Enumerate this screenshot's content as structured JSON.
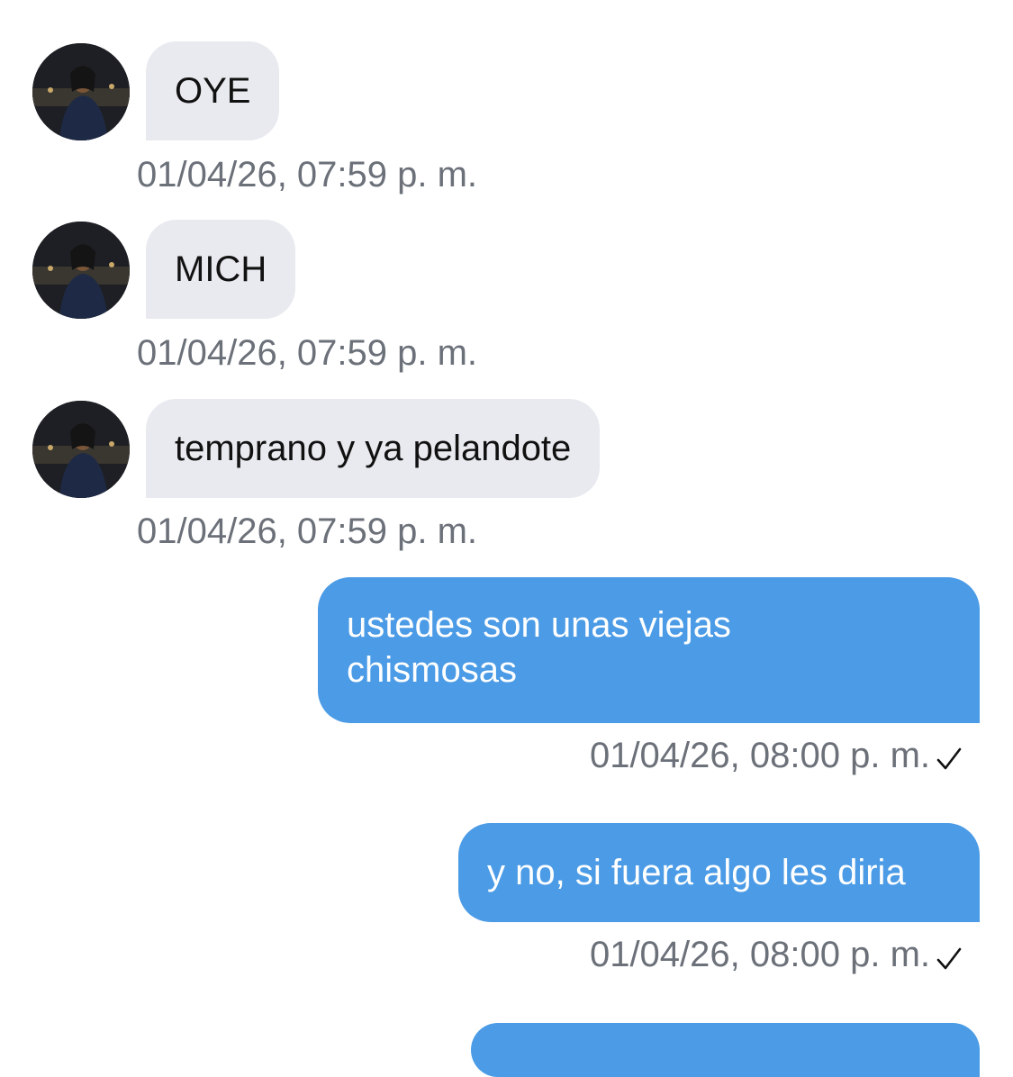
{
  "messages": [
    {
      "direction": "incoming",
      "text": "OYE",
      "timestamp": "01/04/26, 07:59 p. m."
    },
    {
      "direction": "incoming",
      "text": "MICH",
      "timestamp": "01/04/26, 07:59 p. m."
    },
    {
      "direction": "incoming",
      "text": "temprano y ya pelandote",
      "timestamp": "01/04/26, 07:59 p. m."
    },
    {
      "direction": "outgoing",
      "text_lines": [
        "ustedes son unas viejas",
        "chismosas"
      ],
      "timestamp": "01/04/26, 08:00 p. m.",
      "status_icon": "check-icon"
    },
    {
      "direction": "outgoing",
      "text": "y no, si fuera algo les diria",
      "timestamp": "01/04/26, 08:00 p. m.",
      "status_icon": "check-icon"
    }
  ],
  "colors": {
    "incoming_bubble": "#e8eaef",
    "outgoing_bubble": "#4b9be6",
    "timestamp_text": "#6b7079",
    "background": "#ffffff"
  }
}
